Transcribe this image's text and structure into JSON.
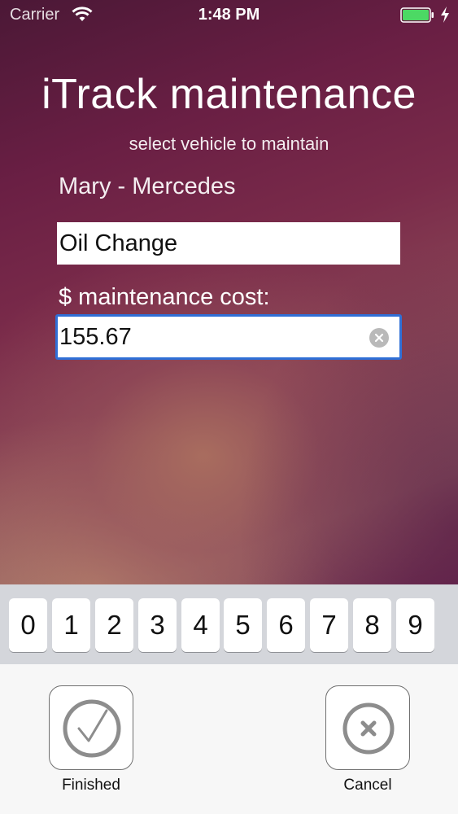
{
  "status_bar": {
    "carrier": "Carrier",
    "time": "1:48 PM",
    "battery_color": "#4cd964"
  },
  "app": {
    "title": "iTrack maintenance",
    "subtitle": "select vehicle to maintain",
    "selected_vehicle": "Mary - Mercedes"
  },
  "form": {
    "maintenance_type_value": "Oil Change",
    "cost_label": "$ maintenance cost:",
    "cost_value": "155.67",
    "focus_color": "#2f6fd6"
  },
  "keypad": {
    "keys": [
      "0",
      "1",
      "2",
      "3",
      "4",
      "5",
      "6",
      "7",
      "8",
      "9"
    ]
  },
  "actions": {
    "finished_label": "Finished",
    "finished_icon": "checkmark-icon",
    "cancel_label": "Cancel",
    "cancel_icon": "close-circle-icon"
  }
}
